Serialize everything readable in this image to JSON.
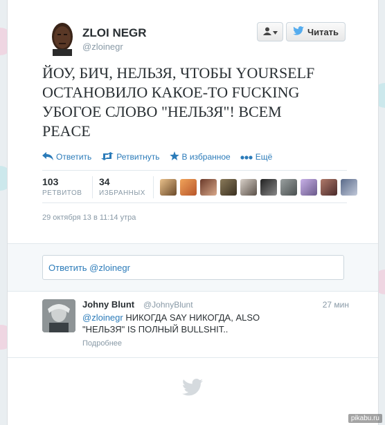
{
  "user": {
    "name": "ZLOI NEGR",
    "handle": "@zloinegr"
  },
  "buttons": {
    "follow_label": "Читать"
  },
  "tweet": {
    "text": "ЙОУ, БИЧ, НЕЛЬЗЯ, ЧТОБЫ YOURSELF ОСТАНОВИЛО КАКОЕ-ТО FUCKING УБОГОЕ СЛОВО \"НЕЛЬЗЯ\"! ВСЕМ PEACE",
    "timestamp": "29 октября 13 в 11:14 утра"
  },
  "actions": {
    "reply": "Ответить",
    "retweet": "Ретвитнуть",
    "favorite": "В избранное",
    "more": "Ещё"
  },
  "stats": {
    "retweets_count": "103",
    "retweets_label": "РЕТВИТОВ",
    "favorites_count": "34",
    "favorites_label": "ИЗБРАННЫХ"
  },
  "reply_box": {
    "text": "Ответить @zloinegr"
  },
  "reply": {
    "name": "Johny Blunt",
    "handle": "@JohnyBlunt",
    "time": "27 мин",
    "mention": "@zloinegr",
    "text": " НИКОГДА SAY НИКОГДА, ALSO \"НЕЛЬЗЯ\" IS ПОЛНЫЙ  BULLSHIT..",
    "more_link": "Подробнее"
  },
  "watermark": "pikabu.ru",
  "colors": {
    "link": "#2b7bb9",
    "text": "#292f33",
    "muted": "#8899a6"
  },
  "icons": [
    "user-icon",
    "twitter-bird-icon",
    "reply-icon",
    "retweet-icon",
    "star-icon",
    "more-dots-icon"
  ]
}
